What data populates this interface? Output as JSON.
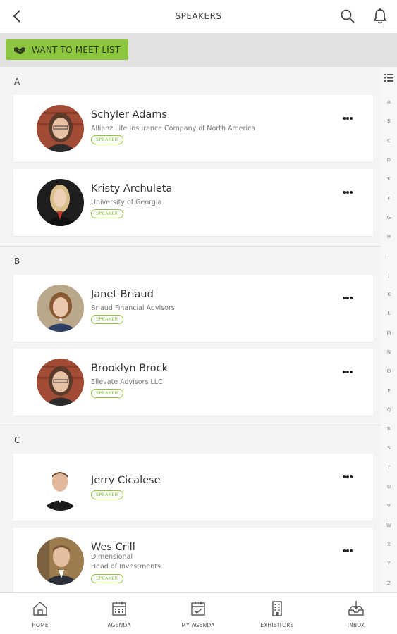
{
  "header": {
    "title": "SPEAKERS"
  },
  "toolbar": {
    "meet_label": "WANT TO MEET LIST"
  },
  "sections": [
    {
      "letter": "A"
    },
    {
      "letter": "B"
    },
    {
      "letter": "C"
    }
  ],
  "speakers": [
    {
      "name": "Schyler Adams",
      "org": "Allianz Life Insurance Company of North America",
      "title": "",
      "badge": "SPEAKER"
    },
    {
      "name": "Kristy Archuleta",
      "org": "University of Georgia",
      "title": "",
      "badge": "SPEAKER"
    },
    {
      "name": "Janet Briaud",
      "org": "Briaud Financial Advisors",
      "title": "",
      "badge": "SPEAKER"
    },
    {
      "name": "Brooklyn Brock",
      "org": "Ellevate Advisors LLC",
      "title": "",
      "badge": "SPEAKER"
    },
    {
      "name": "Jerry Cicalese",
      "org": "",
      "title": "",
      "badge": "SPEAKER"
    },
    {
      "name": "Wes Crill",
      "org": "Dimensional",
      "title": "Head of Investments",
      "badge": "SPEAKER"
    }
  ],
  "index_letters": [
    "A",
    "B",
    "C",
    "D",
    "E",
    "F",
    "G",
    "H",
    "I",
    "J",
    "K",
    "L",
    "M",
    "N",
    "O",
    "P",
    "Q",
    "R",
    "S",
    "T",
    "U",
    "V",
    "W",
    "X",
    "Y",
    "Z"
  ],
  "nav": [
    {
      "label": "HOME",
      "icon": "home-icon"
    },
    {
      "label": "AGENDA",
      "icon": "calendar-icon"
    },
    {
      "label": "MY AGENDA",
      "icon": "calendar-check-icon"
    },
    {
      "label": "EXHIBITORS",
      "icon": "building-icon"
    },
    {
      "label": "INBOX",
      "icon": "inbox-icon"
    }
  ],
  "colors": {
    "accent": "#8cc63f",
    "background": "#f4f4f4",
    "card": "#ffffff"
  }
}
